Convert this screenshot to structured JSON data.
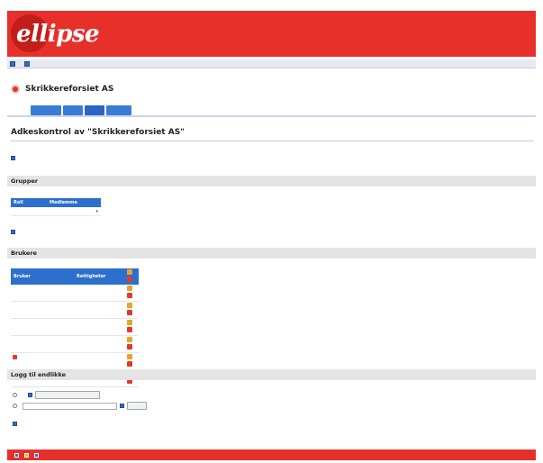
{
  "brand": {
    "logo_text": "ellipse",
    "logo_subtitle": ""
  },
  "topbar": {
    "items": [
      "",
      ""
    ]
  },
  "record": {
    "title": "Skrikkereforsiet AS"
  },
  "tabs": [
    {
      "label": "",
      "active": false
    },
    {
      "label": "",
      "active": false
    },
    {
      "label": "",
      "active": true
    },
    {
      "label": "",
      "active": false
    }
  ],
  "breadcrumbs": [
    "",
    "",
    ""
  ],
  "page": {
    "title": "Adkeskontrol av \"Skrikkereforsiet AS\""
  },
  "info_text": "",
  "sections": {
    "groups": {
      "title": "Grupper",
      "table": {
        "headers": [
          "Roll",
          "Medlemme"
        ],
        "rows": [
          [
            "",
            ""
          ]
        ]
      },
      "add_link": ""
    },
    "users": {
      "title": "Brukere",
      "table": {
        "headers": [
          "Bruker",
          "Rettigheter"
        ],
        "rows": [
          {
            "name": ""
          },
          {
            "name": ""
          },
          {
            "name": ""
          },
          {
            "name": ""
          },
          {
            "name": ""
          },
          {
            "name": ""
          }
        ]
      },
      "add_link": ""
    },
    "inheritance": {
      "title": "Logg til endlikke",
      "option1": {
        "label": "",
        "button": ""
      },
      "option2": {
        "label": "",
        "input_value": "",
        "button": ""
      },
      "save_link": ""
    }
  },
  "footer": {
    "items": [
      {
        "label": "",
        "icon": "none"
      },
      {
        "label": "",
        "icon": "blue"
      },
      {
        "label": "",
        "icon": "yellow"
      },
      {
        "label": "",
        "icon": "blue"
      }
    ]
  },
  "colors": {
    "brand_red": "#e8302b",
    "tab_blue": "#3c7bd3",
    "table_header": "#2d6fcd"
  }
}
